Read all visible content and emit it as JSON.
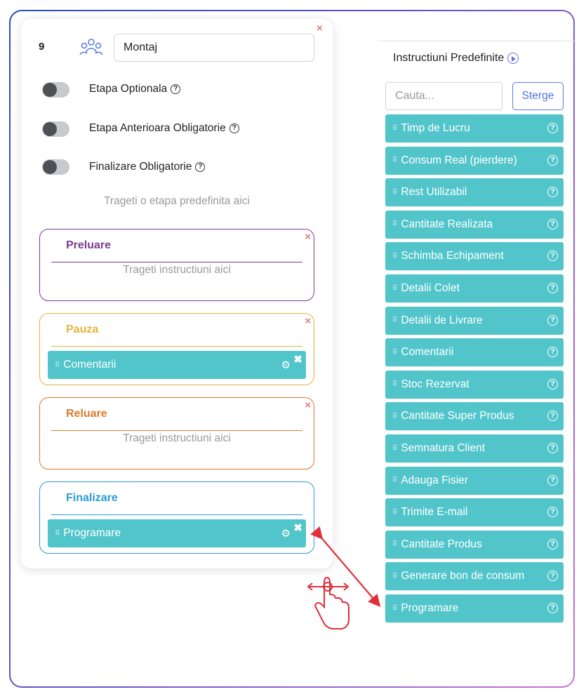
{
  "stage": {
    "number": "9",
    "name": "Montaj",
    "close_icon": "×",
    "toggles": [
      {
        "label": "Etapa Optionala",
        "on": false
      },
      {
        "label": "Etapa Anterioara Obligatorie",
        "on": false
      },
      {
        "label": "Finalizare Obligatorie",
        "on": false
      }
    ],
    "drop_hint": "Trageti o etapa predefinita aici",
    "help_glyph": "?"
  },
  "sub_stages": [
    {
      "title": "Preluare",
      "color": "#7b3a93",
      "hint": "Trageti instructiuni aici",
      "items": []
    },
    {
      "title": "Pauza",
      "color": "#e2b43a",
      "items": [
        {
          "label": "Comentarii"
        }
      ]
    },
    {
      "title": "Reluare",
      "color": "#d97a2a",
      "hint": "Trageti instructiuni aici",
      "items": []
    },
    {
      "title": "Finalizare",
      "color": "#2b9bd4",
      "items": [
        {
          "label": "Programare"
        }
      ]
    }
  ],
  "panel": {
    "title": "Instructiuni Predefinite",
    "search_placeholder": "Cauta...",
    "clear_label": "Sterge",
    "items": [
      "Timp de Lucru",
      "Consum Real (pierdere)",
      "Rest Utilizabil",
      "Cantitate Realizata",
      "Schimba Echipament",
      "Detalii Colet",
      "Detalii de Livrare",
      "Comentarii",
      "Stoc Rezervat",
      "Cantitate Super Produs",
      "Semnatura Client",
      "Adauga Fisier",
      "Trimite E-mail",
      "Cantitate Produs",
      "Generare bon de consum",
      "Programare"
    ]
  },
  "colors": {
    "teal": "#52c5cb",
    "accent_blue": "#4f74e0",
    "close_red": "#e07b7b",
    "drag_arrow": "#e0303a"
  },
  "icons": {
    "grip": "⠿",
    "gear": "⚙",
    "remove": "✖",
    "drag_hint": "hand-pointer-drag-icon"
  }
}
